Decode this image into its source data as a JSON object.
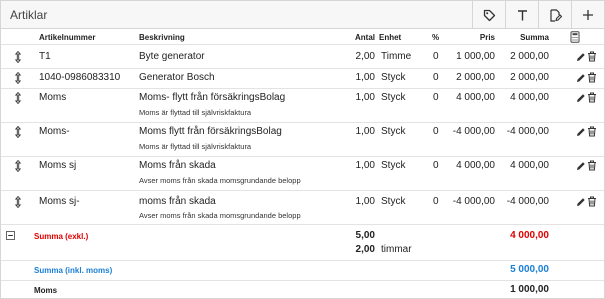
{
  "header": {
    "title": "Artiklar"
  },
  "columns": {
    "article_no": "Artikelnummer",
    "description": "Beskrivning",
    "qty": "Antal",
    "unit": "Enhet",
    "pct": "%",
    "price": "Pris",
    "sum": "Summa"
  },
  "rows": [
    {
      "article_no": "T1",
      "description": "Byte generator",
      "note": "",
      "qty": "2,00",
      "unit": "Timme",
      "pct": "0",
      "price": "1 000,00",
      "sum": "2 000,00"
    },
    {
      "article_no": "1040-0986083310",
      "description": "Generator Bosch",
      "note": "",
      "qty": "1,00",
      "unit": "Styck",
      "pct": "0",
      "price": "2 000,00",
      "sum": "2 000,00"
    },
    {
      "article_no": "Moms",
      "description": "Moms- flytt från försäkringsBolag",
      "note": "Moms är flyttad till självriskfaktura",
      "qty": "1,00",
      "unit": "Styck",
      "pct": "0",
      "price": "4 000,00",
      "sum": "4 000,00"
    },
    {
      "article_no": "Moms-",
      "description": "Moms flytt från försäkringsBolag",
      "note": "Moms är flyttad till självriskfaktura",
      "qty": "1,00",
      "unit": "Styck",
      "pct": "0",
      "price": "-4 000,00",
      "sum": "-4 000,00"
    },
    {
      "article_no": "Moms sj",
      "description": "Moms från skada",
      "note": "Avser moms från skada momsgrundande belopp",
      "qty": "1,00",
      "unit": "Styck",
      "pct": "0",
      "price": "4 000,00",
      "sum": "4 000,00"
    },
    {
      "article_no": "Moms sj-",
      "description": "moms från skada",
      "note": "Avser moms från skada momsgrundande belopp",
      "qty": "1,00",
      "unit": "Styck",
      "pct": "0",
      "price": "-4 000,00",
      "sum": "-4 000,00"
    }
  ],
  "totals": {
    "excl_label": "Summa (exkl.)",
    "excl_qty": "5,00",
    "excl_sum": "4 000,00",
    "hours_qty": "2,00",
    "hours_unit": "timmar",
    "incl_label": "Summa (inkl. moms)",
    "incl_sum": "5 000,00",
    "vat_label": "Moms",
    "vat_sum": "1 000,00"
  },
  "colors": {
    "red": "#e00000",
    "blue": "#1a7fd6",
    "border": "#d6d6d6"
  },
  "icons": {
    "toolbar": [
      "tag-icon",
      "text-icon",
      "document-edit-icon",
      "plus-icon"
    ],
    "header_col": "calculator-icon",
    "row_actions": [
      "pencil-icon",
      "trash-icon"
    ],
    "row_handle": "drag-handle-icon",
    "collapse": "minus-box-icon"
  }
}
